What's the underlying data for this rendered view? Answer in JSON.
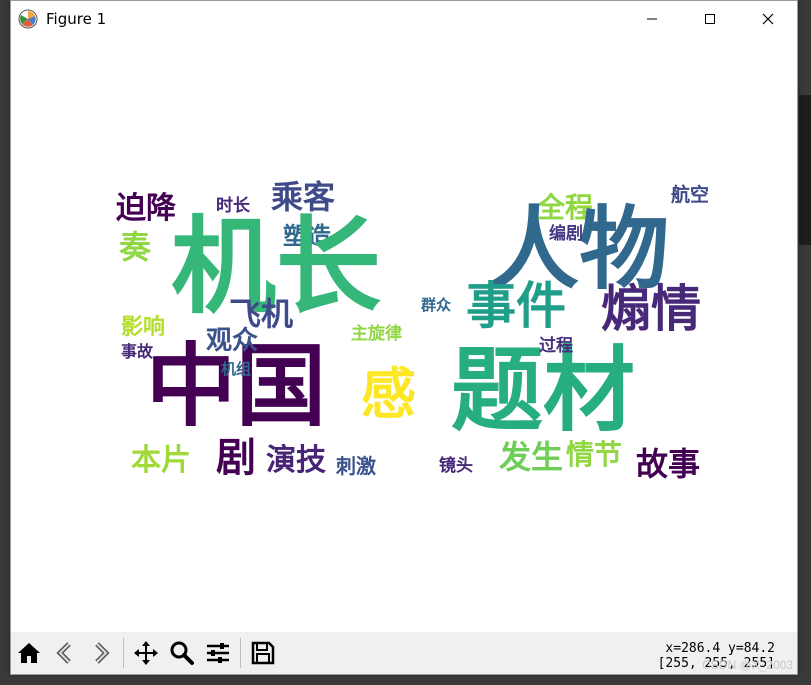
{
  "window": {
    "title": "Figure 1",
    "minimize_glyph": "—",
    "maximize_glyph": "☐",
    "close_glyph": "✕"
  },
  "wordcloud": {
    "words": [
      {
        "text": "迫降",
        "color": "#440154"
      },
      {
        "text": "时长",
        "color": "#482878"
      },
      {
        "text": "乘客",
        "color": "#3e4a89"
      },
      {
        "text": "长",
        "color": "#35b779"
      },
      {
        "text": "全程",
        "color": "#90d743"
      },
      {
        "text": "航空",
        "color": "#3e4a89"
      },
      {
        "text": "塑造",
        "color": "#31688e"
      },
      {
        "text": "人物",
        "color": "#31688e"
      },
      {
        "text": "编剧",
        "color": "#443983"
      },
      {
        "text": "机长",
        "color": "#35b779"
      },
      {
        "text": "事件",
        "color": "#1f9e89"
      },
      {
        "text": "煽情",
        "color": "#482878"
      },
      {
        "text": "飞机",
        "color": "#3e4a89"
      },
      {
        "text": "主旋律",
        "color": "#90d743"
      },
      {
        "text": "群众",
        "color": "#31688e"
      },
      {
        "text": "中国",
        "color": "#440154"
      },
      {
        "text": "题材",
        "color": "#26ad81"
      },
      {
        "text": "过程",
        "color": "#472d7b"
      },
      {
        "text": "机组",
        "color": "#31688e"
      },
      {
        "text": "观众",
        "color": "#3b528b"
      },
      {
        "text": "影响",
        "color": "#b5de2b"
      },
      {
        "text": "事故",
        "color": "#482878"
      },
      {
        "text": "故事",
        "color": "#440154"
      },
      {
        "text": "本片",
        "color": "#a0da39"
      },
      {
        "text": "演技",
        "color": "#482475"
      },
      {
        "text": "刺激",
        "color": "#3b528b"
      },
      {
        "text": "镜头",
        "color": "#482878"
      },
      {
        "text": "发生",
        "color": "#6ece58"
      },
      {
        "text": "情节",
        "color": "#90d743"
      },
      {
        "text": "剧",
        "color": "#440154"
      },
      {
        "text": "感",
        "color": "#fde725"
      },
      {
        "text": "奏",
        "color": "#90d743"
      }
    ]
  },
  "toolbar": {
    "home_label": "Home",
    "back_label": "Back",
    "forward_label": "Forward",
    "pan_label": "Pan",
    "zoom_label": "Zoom",
    "configure_label": "Configure subplots",
    "save_label": "Save"
  },
  "status": {
    "coords": "x=286.4 y=84.2",
    "pixel": "[255, 255, 255]"
  },
  "watermark": "CSDN @X_2003"
}
